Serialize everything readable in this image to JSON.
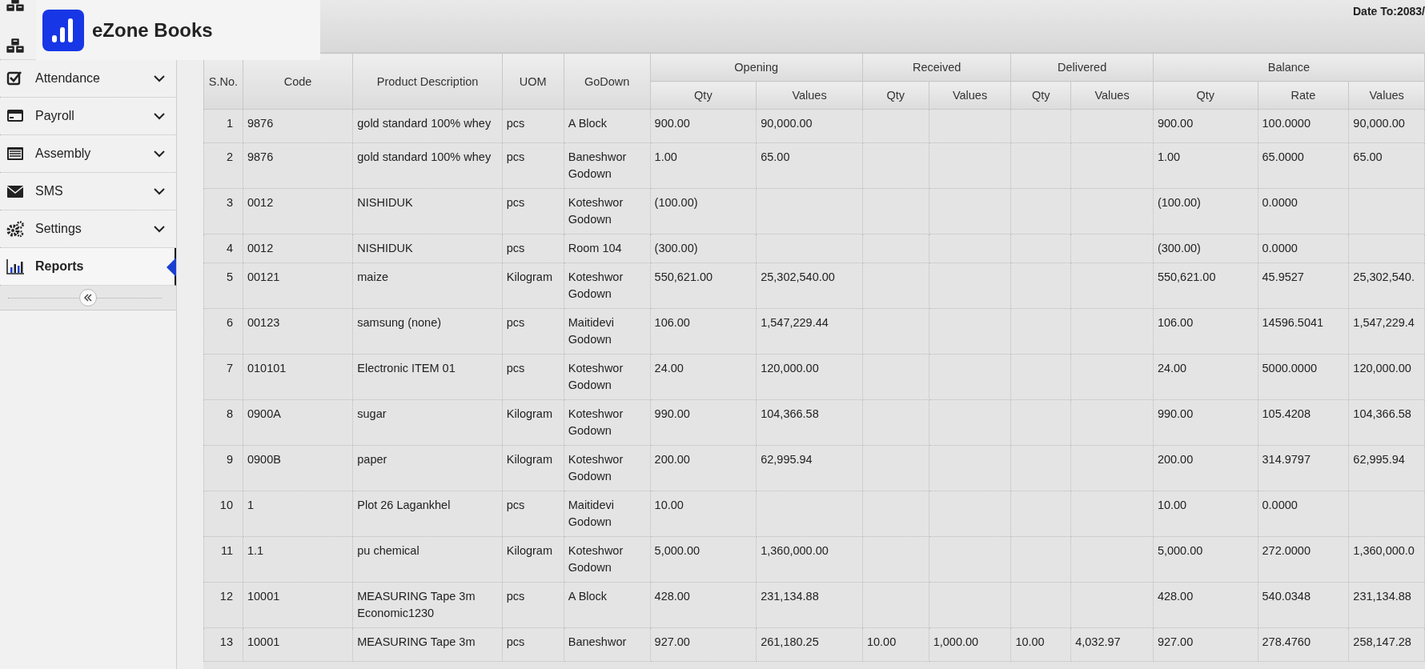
{
  "logo": {
    "name": "eZone Books"
  },
  "header": {
    "date_to": "Date To:2083/"
  },
  "sidebar": {
    "items": [
      {
        "label": "Attendance",
        "selected": false,
        "submenu": true
      },
      {
        "label": "Payroll",
        "selected": false,
        "submenu": true
      },
      {
        "label": "Assembly",
        "selected": false,
        "submenu": true
      },
      {
        "label": "SMS",
        "selected": false,
        "submenu": true
      },
      {
        "label": "Settings",
        "selected": false,
        "submenu": true
      },
      {
        "label": "Reports",
        "selected": true,
        "submenu": false
      }
    ]
  },
  "table": {
    "fixed_columns": [
      "S.No.",
      "Code",
      "Product Description",
      "UOM",
      "GoDown"
    ],
    "groups": [
      {
        "label": "Opening",
        "columns": [
          "Qty",
          "Values"
        ]
      },
      {
        "label": "Received",
        "columns": [
          "Qty",
          "Values"
        ]
      },
      {
        "label": "Delivered",
        "columns": [
          "Qty",
          "Values"
        ]
      },
      {
        "label": "Balance",
        "columns": [
          "Qty",
          "Rate",
          "Values"
        ]
      }
    ],
    "rows": [
      {
        "cells": [
          "1",
          "9876",
          "gold standard 100% whey",
          "pcs",
          "A Block",
          "900.00",
          "90,000.00",
          null,
          null,
          null,
          null,
          "900.00",
          "100.0000",
          "90,000.00"
        ]
      },
      {
        "cells": [
          "2",
          "9876",
          "gold standard 100% whey",
          "pcs",
          "Baneshwor Godown",
          "1.00",
          "65.00",
          null,
          null,
          null,
          null,
          "1.00",
          "65.0000",
          "65.00"
        ]
      },
      {
        "cells": [
          "3",
          "0012",
          "NISHIDUK",
          "pcs",
          "Koteshwor Godown",
          "(100.00)",
          null,
          null,
          null,
          null,
          null,
          "(100.00)",
          "0.0000",
          null
        ]
      },
      {
        "cells": [
          "4",
          "0012",
          "NISHIDUK",
          "pcs",
          "Room 104",
          "(300.00)",
          null,
          null,
          null,
          null,
          null,
          "(300.00)",
          "0.0000",
          null
        ]
      },
      {
        "cells": [
          "5",
          "00121",
          "maize",
          "Kilogram",
          "Koteshwor Godown",
          "550,621.00",
          "25,302,540.00",
          null,
          null,
          null,
          null,
          "550,621.00",
          "45.9527",
          "25,302,540."
        ]
      },
      {
        "cells": [
          "6",
          "00123",
          "samsung (none)",
          "pcs",
          "Maitidevi Godown",
          "106.00",
          "1,547,229.44",
          null,
          null,
          null,
          null,
          "106.00",
          "14596.5041",
          "1,547,229.4"
        ]
      },
      {
        "cells": [
          "7",
          "010101",
          "Electronic ITEM 01",
          "pcs",
          "Koteshwor Godown",
          "24.00",
          "120,000.00",
          null,
          null,
          null,
          null,
          "24.00",
          "5000.0000",
          "120,000.00"
        ]
      },
      {
        "cells": [
          "8",
          "0900A",
          "sugar",
          "Kilogram",
          "Koteshwor Godown",
          "990.00",
          "104,366.58",
          null,
          null,
          null,
          null,
          "990.00",
          "105.4208",
          "104,366.58"
        ]
      },
      {
        "cells": [
          "9",
          "0900B",
          "paper",
          "Kilogram",
          "Koteshwor Godown",
          "200.00",
          "62,995.94",
          null,
          null,
          null,
          null,
          "200.00",
          "314.9797",
          "62,995.94"
        ]
      },
      {
        "cells": [
          "10",
          "1",
          "Plot 26 Lagankhel",
          "pcs",
          "Maitidevi Godown",
          "10.00",
          null,
          null,
          null,
          null,
          null,
          "10.00",
          "0.0000",
          null
        ]
      },
      {
        "cells": [
          "11",
          "1.1",
          "pu chemical",
          "Kilogram",
          "Koteshwor Godown",
          "5,000.00",
          "1,360,000.00",
          null,
          null,
          null,
          null,
          "5,000.00",
          "272.0000",
          "1,360,000.0"
        ]
      },
      {
        "cells": [
          "12",
          "10001",
          "MEASURING Tape 3m Economic1230",
          "pcs",
          "A Block",
          "428.00",
          "231,134.88",
          null,
          null,
          null,
          null,
          "428.00",
          "540.0348",
          "231,134.88"
        ]
      },
      {
        "cells": [
          "13",
          "10001",
          "MEASURING Tape 3m",
          "pcs",
          "Baneshwor",
          "927.00",
          "261,180.25",
          "10.00",
          "1,000.00",
          "10.00",
          "4,032.97",
          "927.00",
          "278.4760",
          "258,147.28"
        ]
      }
    ]
  }
}
